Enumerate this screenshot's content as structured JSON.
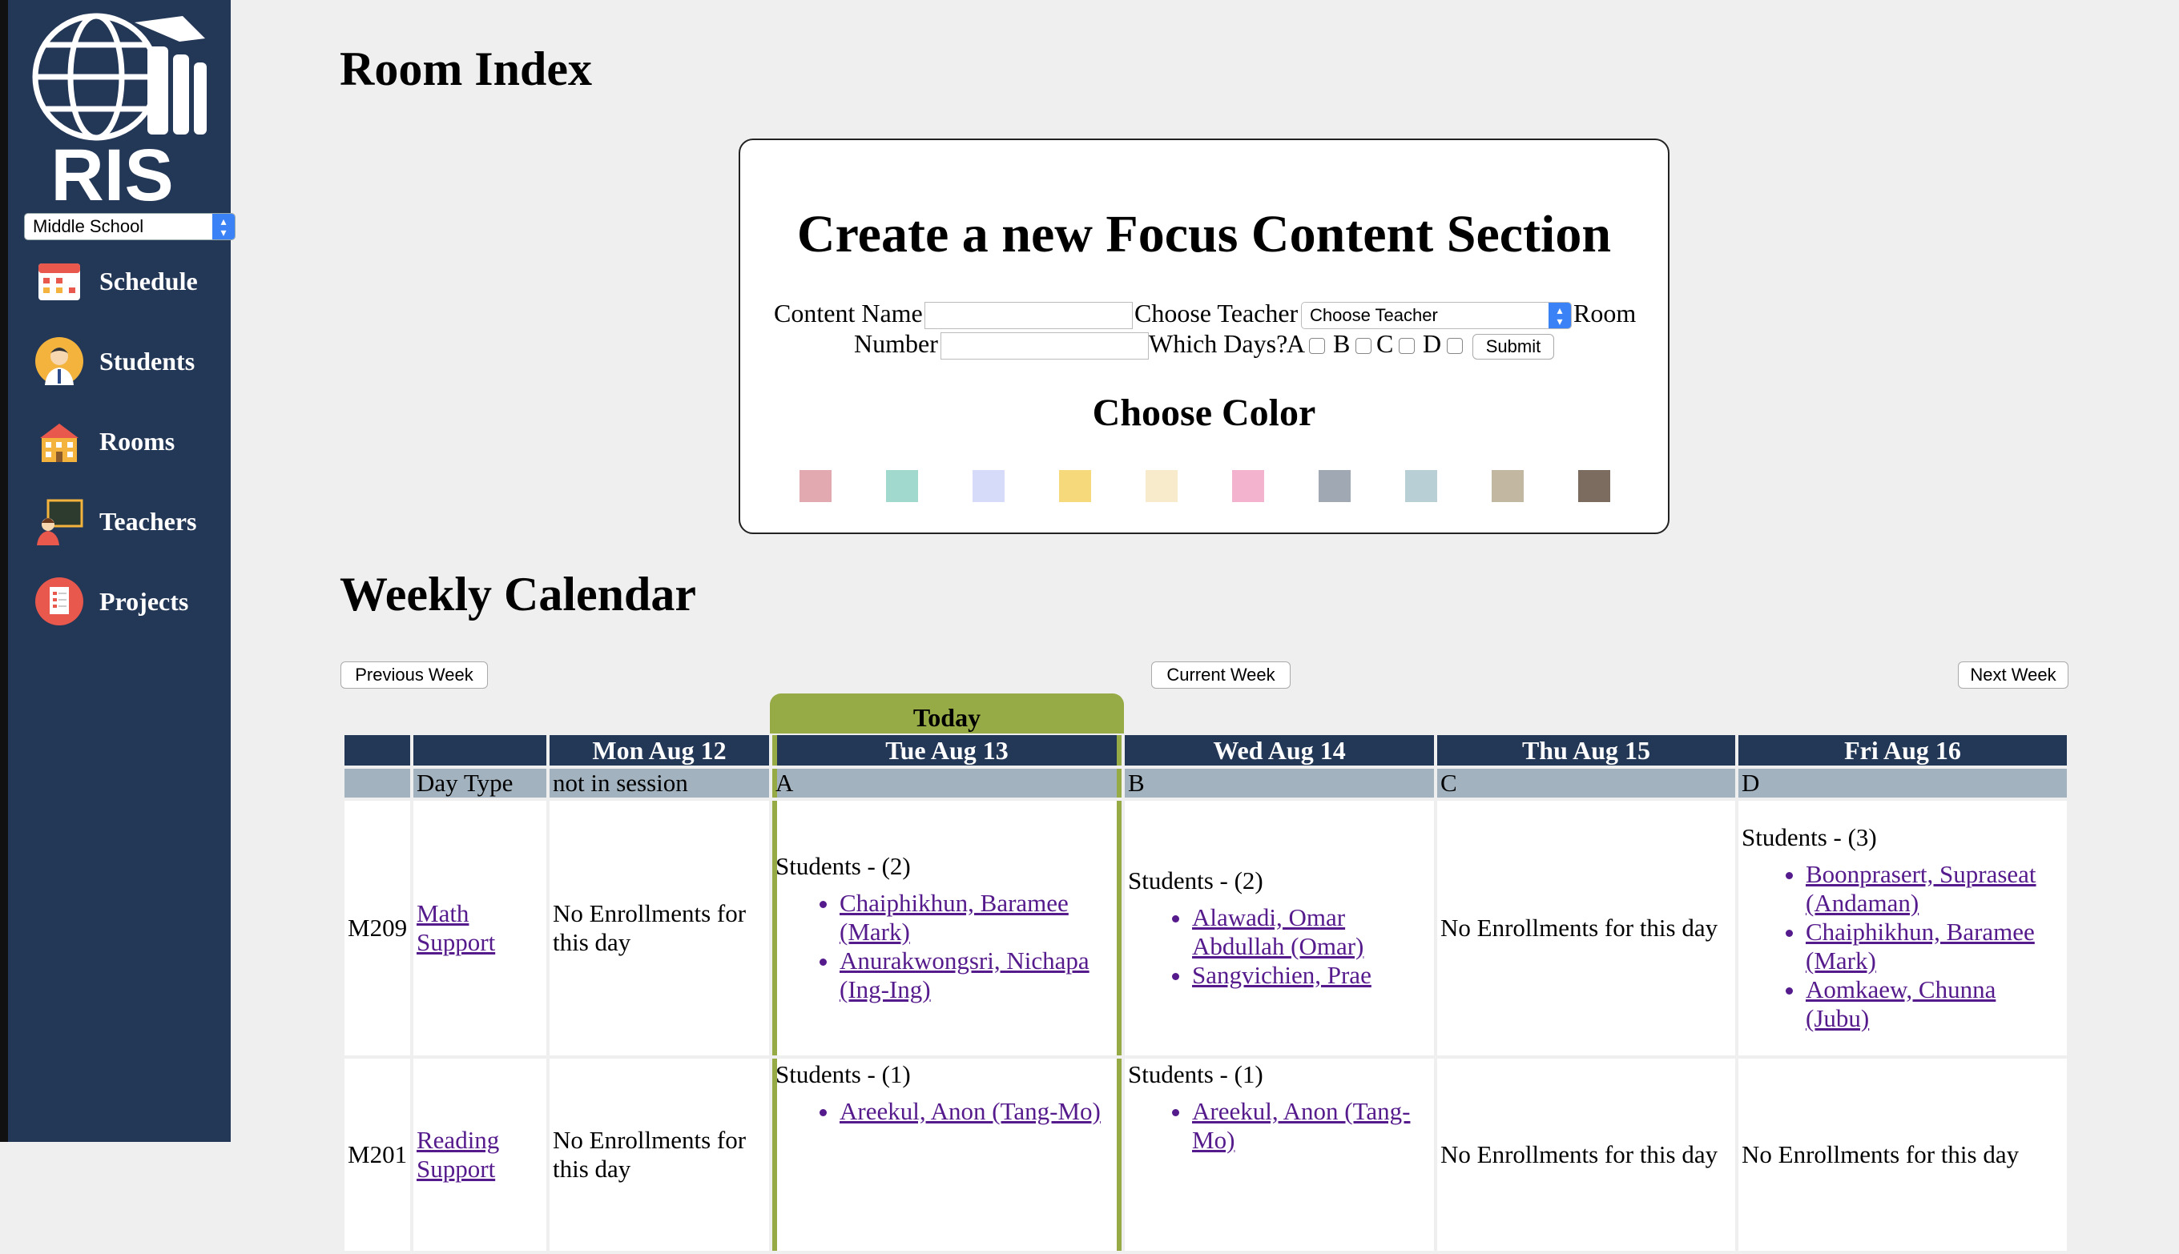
{
  "sidebar": {
    "logo_text": "RIS",
    "school_select": "Middle School",
    "items": [
      {
        "label": "Schedule",
        "icon": "calendar-icon"
      },
      {
        "label": "Students",
        "icon": "student-icon"
      },
      {
        "label": "Rooms",
        "icon": "school-building-icon"
      },
      {
        "label": "Teachers",
        "icon": "teacher-icon"
      },
      {
        "label": "Projects",
        "icon": "projects-icon"
      }
    ]
  },
  "page_title": "Room Index",
  "focus_form": {
    "heading": "Create a new Focus Content Section",
    "content_name_label": "Content Name",
    "content_name_value": "",
    "choose_teacher_label": "Choose Teacher",
    "teacher_select": "Choose Teacher",
    "room_label": "Room",
    "number_label": "Number",
    "number_value": "",
    "which_days_label": "Which Days?",
    "days": [
      "A",
      "B",
      "C",
      "D"
    ],
    "submit_label": "Submit",
    "color_heading": "Choose Color",
    "colors": [
      "#e3a9b0",
      "#a2d9cf",
      "#d6dbf9",
      "#f6d97b",
      "#f8ebcc",
      "#f3b3cf",
      "#a0a8b4",
      "#b9cfd6",
      "#c2b8a1",
      "#7b6c5f"
    ]
  },
  "calendar": {
    "heading": "Weekly Calendar",
    "prev_label": "Previous Week",
    "current_label": "Current Week",
    "next_label": "Next Week",
    "today_label": "Today",
    "days": [
      {
        "header": "Mon Aug 12",
        "type": "not in session"
      },
      {
        "header": "Tue Aug 13",
        "type": "A"
      },
      {
        "header": "Wed Aug 14",
        "type": "B"
      },
      {
        "header": "Thu Aug 15",
        "type": "C"
      },
      {
        "header": "Fri Aug 16",
        "type": "D"
      }
    ],
    "day_type_label": "Day Type",
    "rows": [
      {
        "room": "M209",
        "section": "Math Support",
        "cells": [
          {
            "text": "No Enrollments for this day"
          },
          {
            "heading": "Students - (2)",
            "students": [
              "Chaiphikhun, Baramee (Mark)",
              "Anurakwongsri, Nichapa (Ing-Ing)"
            ]
          },
          {
            "heading": "Students - (2)",
            "students": [
              "Alawadi, Omar Abdullah (Omar)",
              "Sangvichien, Prae"
            ]
          },
          {
            "text": "No Enrollments for this day"
          },
          {
            "heading": "Students - (3)",
            "students": [
              "Boonprasert, Supraseat (Andaman)",
              "Chaiphikhun, Baramee (Mark)",
              "Aomkaew, Chunna (Jubu)"
            ]
          }
        ]
      },
      {
        "room": "M201",
        "section": "Reading Support",
        "cells": [
          {
            "text": "No Enrollments for this day"
          },
          {
            "heading": "Students - (1)",
            "students": [
              "Areekul, Anon (Tang-Mo)"
            ]
          },
          {
            "heading": "Students - (1)",
            "students": [
              "Areekul, Anon (Tang-Mo)"
            ]
          },
          {
            "text": "No Enrollments for this day"
          },
          {
            "text": "No Enrollments for this day"
          }
        ]
      }
    ]
  }
}
